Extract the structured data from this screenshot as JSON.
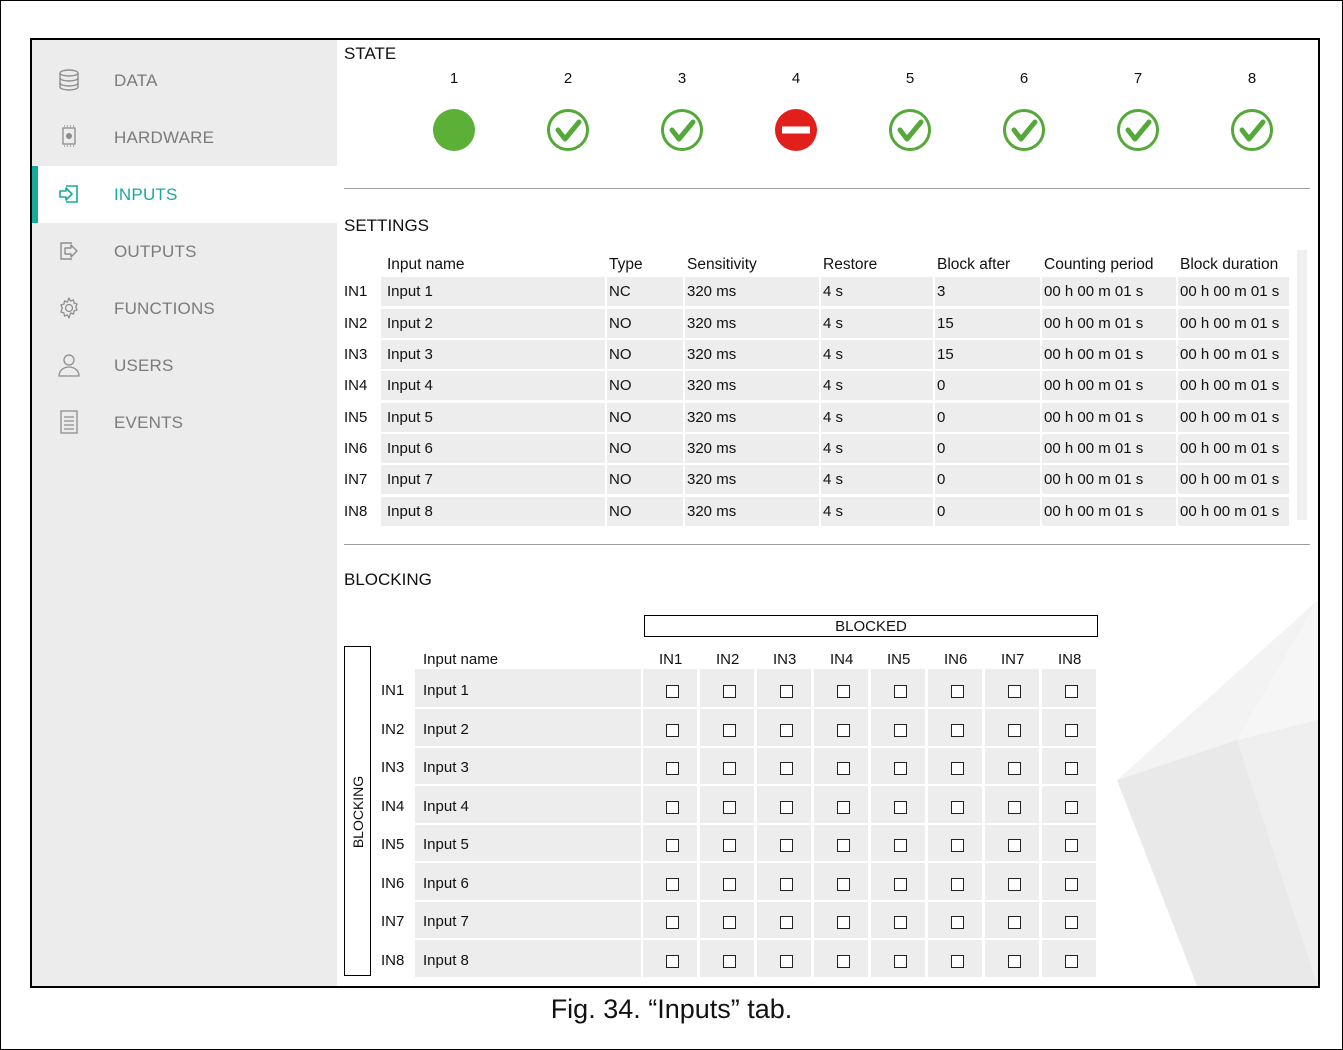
{
  "sidebar": {
    "items": [
      {
        "label": "DATA",
        "icon": "database-icon",
        "active": false
      },
      {
        "label": "HARDWARE",
        "icon": "chip-icon",
        "active": false
      },
      {
        "label": "INPUTS",
        "icon": "input-icon",
        "active": true
      },
      {
        "label": "OUTPUTS",
        "icon": "output-icon",
        "active": false
      },
      {
        "label": "FUNCTIONS",
        "icon": "gear-icon",
        "active": false
      },
      {
        "label": "USERS",
        "icon": "user-icon",
        "active": false
      },
      {
        "label": "EVENTS",
        "icon": "list-icon",
        "active": false
      }
    ]
  },
  "state": {
    "title": "STATE",
    "inputs": [
      {
        "number": "1",
        "status": "active",
        "icon": "green-dot-icon"
      },
      {
        "number": "2",
        "status": "ok",
        "icon": "check-circle-icon"
      },
      {
        "number": "3",
        "status": "ok",
        "icon": "check-circle-icon"
      },
      {
        "number": "4",
        "status": "blocked",
        "icon": "no-entry-icon"
      },
      {
        "number": "5",
        "status": "ok",
        "icon": "check-circle-icon"
      },
      {
        "number": "6",
        "status": "ok",
        "icon": "check-circle-icon"
      },
      {
        "number": "7",
        "status": "ok",
        "icon": "check-circle-icon"
      },
      {
        "number": "8",
        "status": "ok",
        "icon": "check-circle-icon"
      }
    ]
  },
  "settings": {
    "title": "SETTINGS",
    "headers": [
      "Input name",
      "Type",
      "Sensitivity",
      "Restore",
      "Block after",
      "Counting period",
      "Block duration"
    ],
    "rows": [
      {
        "id": "IN1",
        "name": "Input 1",
        "type": "NC",
        "sensitivity": "320 ms",
        "restore": "4 s",
        "block_after": "3",
        "counting": "00 h 00 m 01 s",
        "duration": "00 h 00 m 01 s"
      },
      {
        "id": "IN2",
        "name": "Input 2",
        "type": "NO",
        "sensitivity": "320 ms",
        "restore": "4 s",
        "block_after": "15",
        "counting": "00 h 00 m 01 s",
        "duration": "00 h 00 m 01 s"
      },
      {
        "id": "IN3",
        "name": "Input 3",
        "type": "NO",
        "sensitivity": "320 ms",
        "restore": "4 s",
        "block_after": "15",
        "counting": "00 h 00 m 01 s",
        "duration": "00 h 00 m 01 s"
      },
      {
        "id": "IN4",
        "name": "Input 4",
        "type": "NO",
        "sensitivity": "320 ms",
        "restore": "4 s",
        "block_after": "0",
        "counting": "00 h 00 m 01 s",
        "duration": "00 h 00 m 01 s"
      },
      {
        "id": "IN5",
        "name": "Input 5",
        "type": "NO",
        "sensitivity": "320 ms",
        "restore": "4 s",
        "block_after": "0",
        "counting": "00 h 00 m 01 s",
        "duration": "00 h 00 m 01 s"
      },
      {
        "id": "IN6",
        "name": "Input 6",
        "type": "NO",
        "sensitivity": "320 ms",
        "restore": "4 s",
        "block_after": "0",
        "counting": "00 h 00 m 01 s",
        "duration": "00 h 00 m 01 s"
      },
      {
        "id": "IN7",
        "name": "Input 7",
        "type": "NO",
        "sensitivity": "320 ms",
        "restore": "4 s",
        "block_after": "0",
        "counting": "00 h 00 m 01 s",
        "duration": "00 h 00 m 01 s"
      },
      {
        "id": "IN8",
        "name": "Input 8",
        "type": "NO",
        "sensitivity": "320 ms",
        "restore": "4 s",
        "block_after": "0",
        "counting": "00 h 00 m 01 s",
        "duration": "00 h 00 m 01 s"
      }
    ]
  },
  "blocking": {
    "title": "BLOCKING",
    "blocked_header": "BLOCKED",
    "side_label": "BLOCKING",
    "name_header": "Input name",
    "columns": [
      "IN1",
      "IN2",
      "IN3",
      "IN4",
      "IN5",
      "IN6",
      "IN7",
      "IN8"
    ],
    "rows": [
      {
        "id": "IN1",
        "name": "Input 1",
        "checked": [
          false,
          false,
          false,
          false,
          false,
          false,
          false,
          false
        ]
      },
      {
        "id": "IN2",
        "name": "Input 2",
        "checked": [
          false,
          false,
          false,
          false,
          false,
          false,
          false,
          false
        ]
      },
      {
        "id": "IN3",
        "name": "Input 3",
        "checked": [
          false,
          false,
          false,
          false,
          false,
          false,
          false,
          false
        ]
      },
      {
        "id": "IN4",
        "name": "Input 4",
        "checked": [
          false,
          false,
          false,
          false,
          false,
          false,
          false,
          false
        ]
      },
      {
        "id": "IN5",
        "name": "Input 5",
        "checked": [
          false,
          false,
          false,
          false,
          false,
          false,
          false,
          false
        ]
      },
      {
        "id": "IN6",
        "name": "Input 6",
        "checked": [
          false,
          false,
          false,
          false,
          false,
          false,
          false,
          false
        ]
      },
      {
        "id": "IN7",
        "name": "Input 7",
        "checked": [
          false,
          false,
          false,
          false,
          false,
          false,
          false,
          false
        ]
      },
      {
        "id": "IN8",
        "name": "Input 8",
        "checked": [
          false,
          false,
          false,
          false,
          false,
          false,
          false,
          false
        ]
      }
    ]
  },
  "caption": "Fig. 34. “Inputs” tab.",
  "colors": {
    "accent": "#19a99b",
    "ok_green": "#56b03a",
    "blocked_red": "#e0201b",
    "sidebar_bg": "#ececec"
  }
}
